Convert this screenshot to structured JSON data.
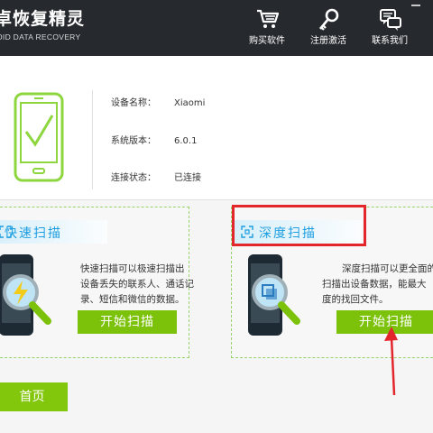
{
  "app": {
    "title": "卓恢复精灵",
    "subtitle": "OID DATA RECOVERY"
  },
  "header_buttons": [
    {
      "label": "购买软件",
      "icon": "shopping-cart-icon"
    },
    {
      "label": "注册激活",
      "icon": "key-icon"
    },
    {
      "label": "联系我们",
      "icon": "chat-icon"
    }
  ],
  "device": {
    "name_label": "设备名称：",
    "name_value": "Xiaomi",
    "version_label": "系统版本：",
    "version_value": "6.0.1",
    "status_label": "连接状态：",
    "status_value": "已连接"
  },
  "quick_scan": {
    "title": "快速扫描",
    "desc_lines": [
      "快速扫描可以极速扫描出",
      "设备丢失的联系人、通话记",
      "录、短信和微信的数据。"
    ],
    "button": "开始扫描"
  },
  "deep_scan": {
    "title": "深度扫描",
    "desc_lines": [
      "深度扫描可以更全面的",
      "扫描出设备数据，能最大",
      "度的找回文件。"
    ],
    "button": "开始扫描"
  },
  "home_button": "首页",
  "colors": {
    "header_bg": "#262a2e",
    "accent_green": "#7cc10a",
    "title_blue": "#1d9ee0",
    "highlight_red": "#e3252c"
  }
}
